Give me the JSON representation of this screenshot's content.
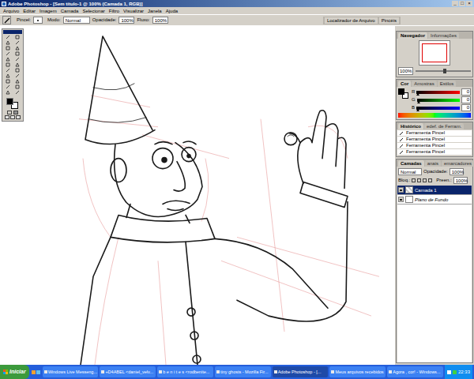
{
  "window": {
    "title": "Adobe Photoshop - [Sem título-1 @ 100% (Camada 1, RGB)]",
    "controls": [
      "_",
      "□",
      "×"
    ]
  },
  "menu": [
    "Arquivo",
    "Editar",
    "Imagem",
    "Camada",
    "Selecionar",
    "Filtro",
    "Visualizar",
    "Janela",
    "Ajuda"
  ],
  "options": {
    "brush_label": "Pincel:",
    "mode_label": "Modo:",
    "mode": "Normal",
    "opacity_label": "Opacidade:",
    "opacity": "100%",
    "flow_label": "Fluxo:",
    "flow": "100%"
  },
  "palette_well": [
    "Localizador de Arquivo",
    "Pincéis"
  ],
  "navigator": {
    "tabs": [
      {
        "label": "Navegador",
        "selected": true
      },
      {
        "label": "Informações",
        "selected": false
      }
    ],
    "zoom": "100%",
    "level": 0.5
  },
  "color": {
    "tabs": [
      {
        "label": "Cor",
        "selected": true
      },
      {
        "label": "Amostras",
        "selected": false
      },
      {
        "label": "Estilos",
        "selected": false
      }
    ],
    "channels": [
      {
        "name": "R",
        "value": "0",
        "level": 0,
        "color": "#ff0000"
      },
      {
        "name": "G",
        "value": "0",
        "level": 0,
        "color": "#00ff00"
      },
      {
        "name": "B",
        "value": "0",
        "level": 0,
        "color": "#0000ff"
      }
    ]
  },
  "history": {
    "tabs": [
      {
        "label": "Histórico",
        "selected": true
      },
      {
        "label": "edef. de Ferram.",
        "selected": false
      }
    ],
    "items": [
      {
        "label": "Ferramenta Pincel",
        "selected": false
      },
      {
        "label": "Ferramenta Pincel",
        "selected": false
      },
      {
        "label": "Ferramenta Pincel",
        "selected": false
      },
      {
        "label": "Ferramenta Pincel",
        "selected": false
      }
    ]
  },
  "layers": {
    "tabs": [
      {
        "label": "Camadas",
        "selected": true
      },
      {
        "label": "anais",
        "selected": false
      },
      {
        "label": "emarcadores",
        "selected": false
      }
    ],
    "blend": "Normal",
    "opacity_label": "Opacidade:",
    "opacity": "100%",
    "lock_label": "Bloq.:",
    "fill_label": "Preen.:",
    "fill": "100%",
    "items": [
      {
        "name": "Camada 1",
        "selected": true,
        "visible": true,
        "kind": "layer"
      },
      {
        "name": "Plano de Fundo",
        "selected": false,
        "visible": true,
        "kind": "background"
      }
    ]
  },
  "taskbar": {
    "start": "Iniciar",
    "items": [
      {
        "label": "Windows Live Messeng...",
        "selected": false
      },
      {
        "label": "+D4ABEL <daniel_velv...",
        "selected": false
      },
      {
        "label": "b e n i t e s <rodbenite...",
        "selected": false
      },
      {
        "label": "tiny ghosts - Mozilla Fir...",
        "selected": false
      },
      {
        "label": "Adobe Photoshop - [...",
        "selected": true
      },
      {
        "label": "Meus arquivos recebidos",
        "selected": false
      },
      {
        "label": "Agora , cor! - Windows...",
        "selected": false
      }
    ],
    "clock": "22:33"
  }
}
